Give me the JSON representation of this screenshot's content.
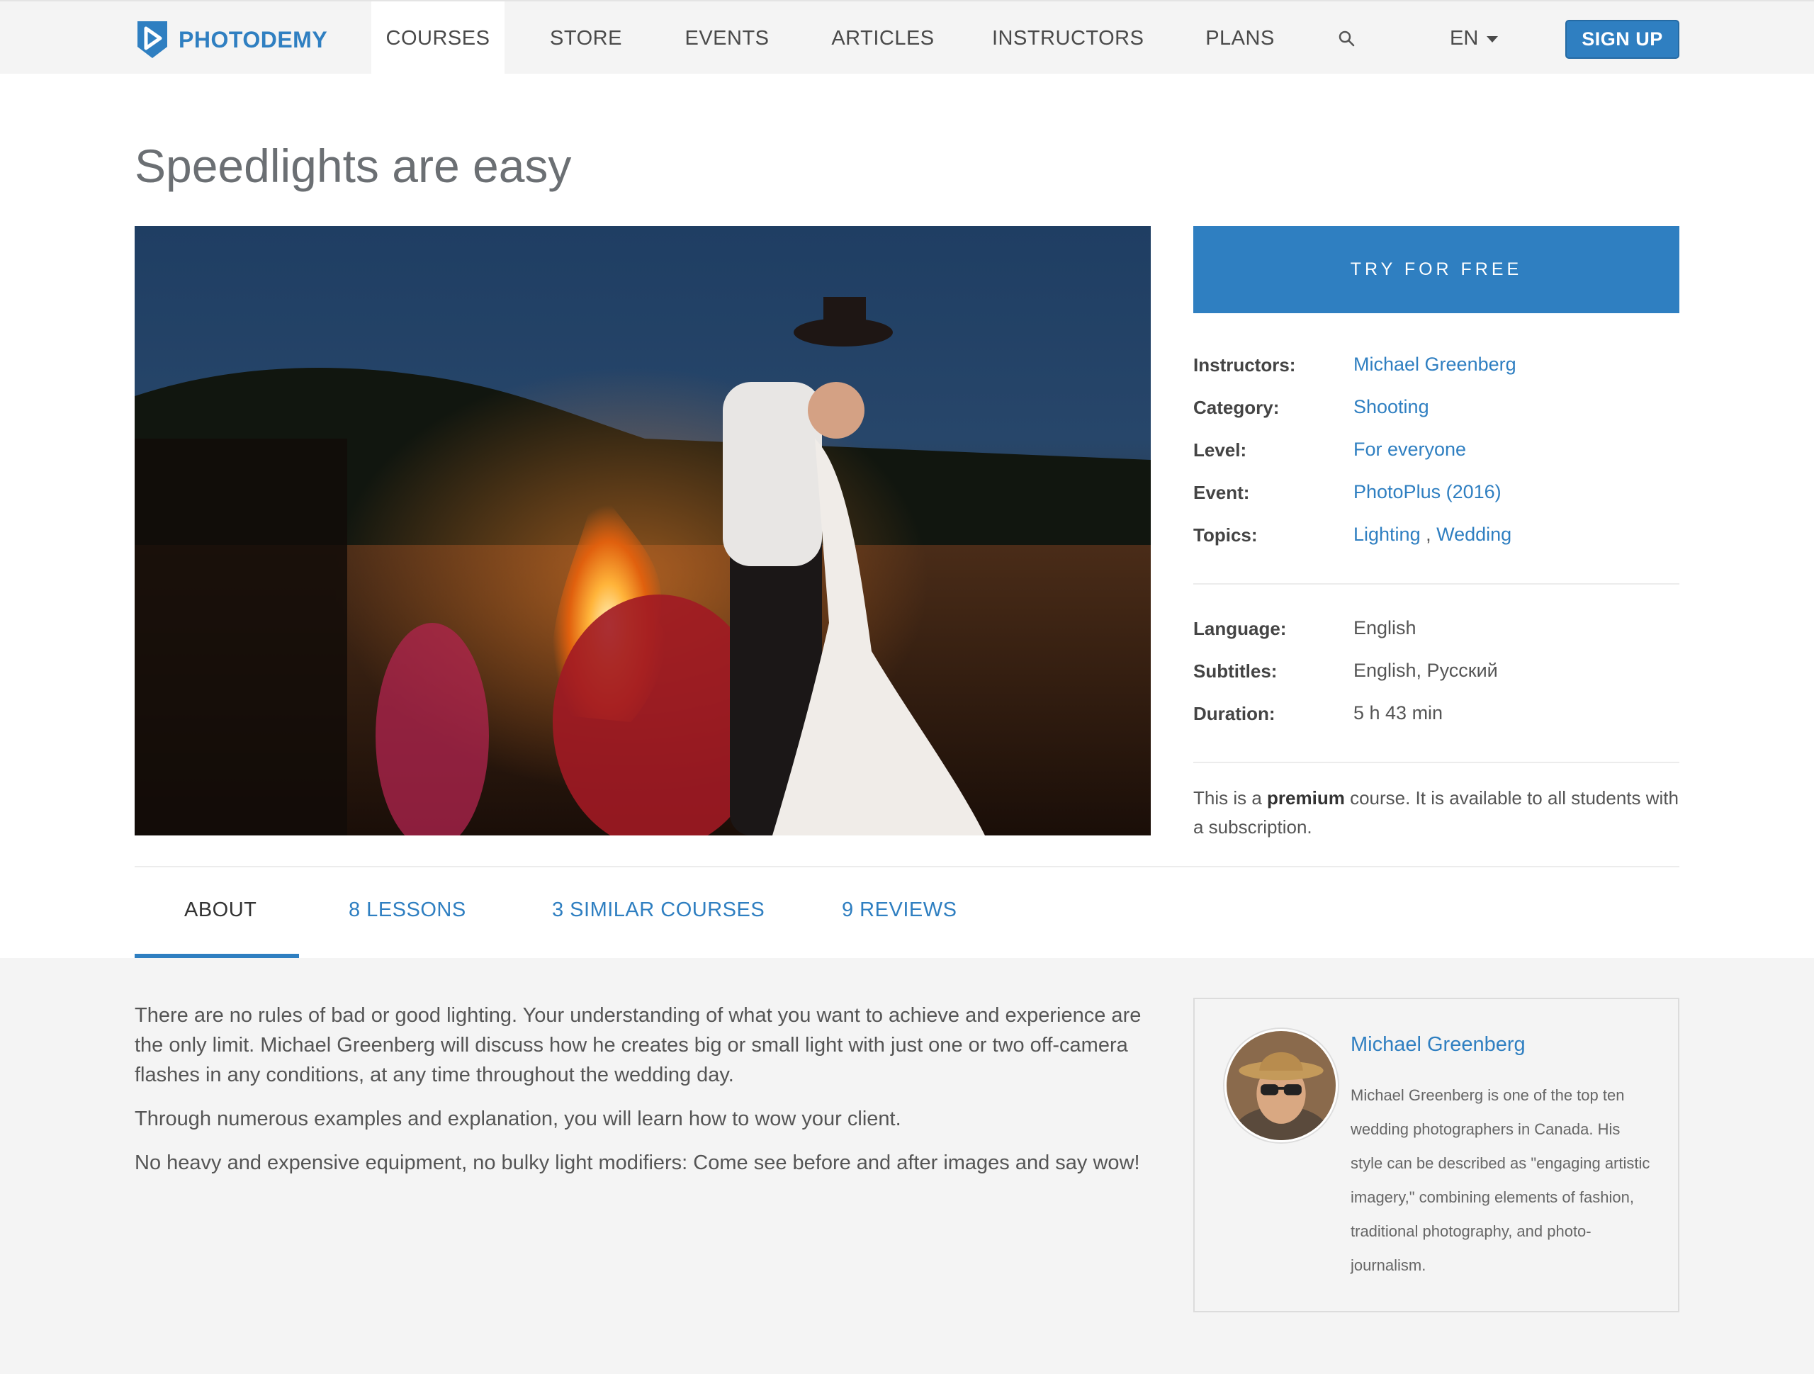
{
  "brand": {
    "name": "PHOTODEMY",
    "color": "#2f7fc1"
  },
  "nav": {
    "items": [
      {
        "label": "COURSES",
        "active": true
      },
      {
        "label": "STORE"
      },
      {
        "label": "EVENTS"
      },
      {
        "label": "ARTICLES"
      },
      {
        "label": "INSTRUCTORS"
      },
      {
        "label": "PLANS"
      }
    ],
    "search_icon": "search-icon",
    "language": "EN",
    "signup_label": "SIGN UP"
  },
  "course": {
    "title": "Speedlights are easy",
    "try_label": "TRY FOR FREE",
    "details": {
      "instructors": {
        "label": "Instructors:",
        "value": "Michael Greenberg"
      },
      "category": {
        "label": "Category:",
        "value": "Shooting"
      },
      "level": {
        "label": "Level:",
        "value": "For everyone"
      },
      "event": {
        "label": "Event:",
        "value": "PhotoPlus (2016)"
      },
      "topics": {
        "label": "Topics:",
        "values": [
          "Lighting",
          "Wedding"
        ],
        "separator": " , "
      }
    },
    "meta": {
      "language": {
        "label": "Language:",
        "value": "English"
      },
      "subtitles": {
        "label": "Subtitles:",
        "value": "English, Русский"
      },
      "duration": {
        "label": "Duration:",
        "value": "5 h 43 min"
      }
    },
    "premium_note": {
      "before": "This is a ",
      "bold": "premium",
      "after": " course. It is available to all students with a subscription."
    }
  },
  "tabs": [
    {
      "label": "ABOUT",
      "active": true
    },
    {
      "label": "8 LESSONS"
    },
    {
      "label": "3 SIMILAR COURSES"
    },
    {
      "label": "9 REVIEWS"
    }
  ],
  "about": {
    "paragraphs": [
      "There are no rules of bad or good lighting. Your understanding of what you want to achieve and experience are the only limit. Michael Greenberg will discuss how he creates big or small light with just one or two off-camera flashes in any conditions, at any time throughout the wedding day.",
      "Through numerous examples and explanation, you will learn how to wow your client.",
      "No heavy and expensive equipment, no bulky light modifiers: Come see before and after images and say wow!"
    ]
  },
  "author": {
    "name": "Michael Greenberg",
    "bio": "Michael Greenberg is one of the top ten wedding photographers in Canada. His style can be described as \"engaging artistic imagery,\" combining elements of fashion, traditional photography, and photo-journalism."
  }
}
